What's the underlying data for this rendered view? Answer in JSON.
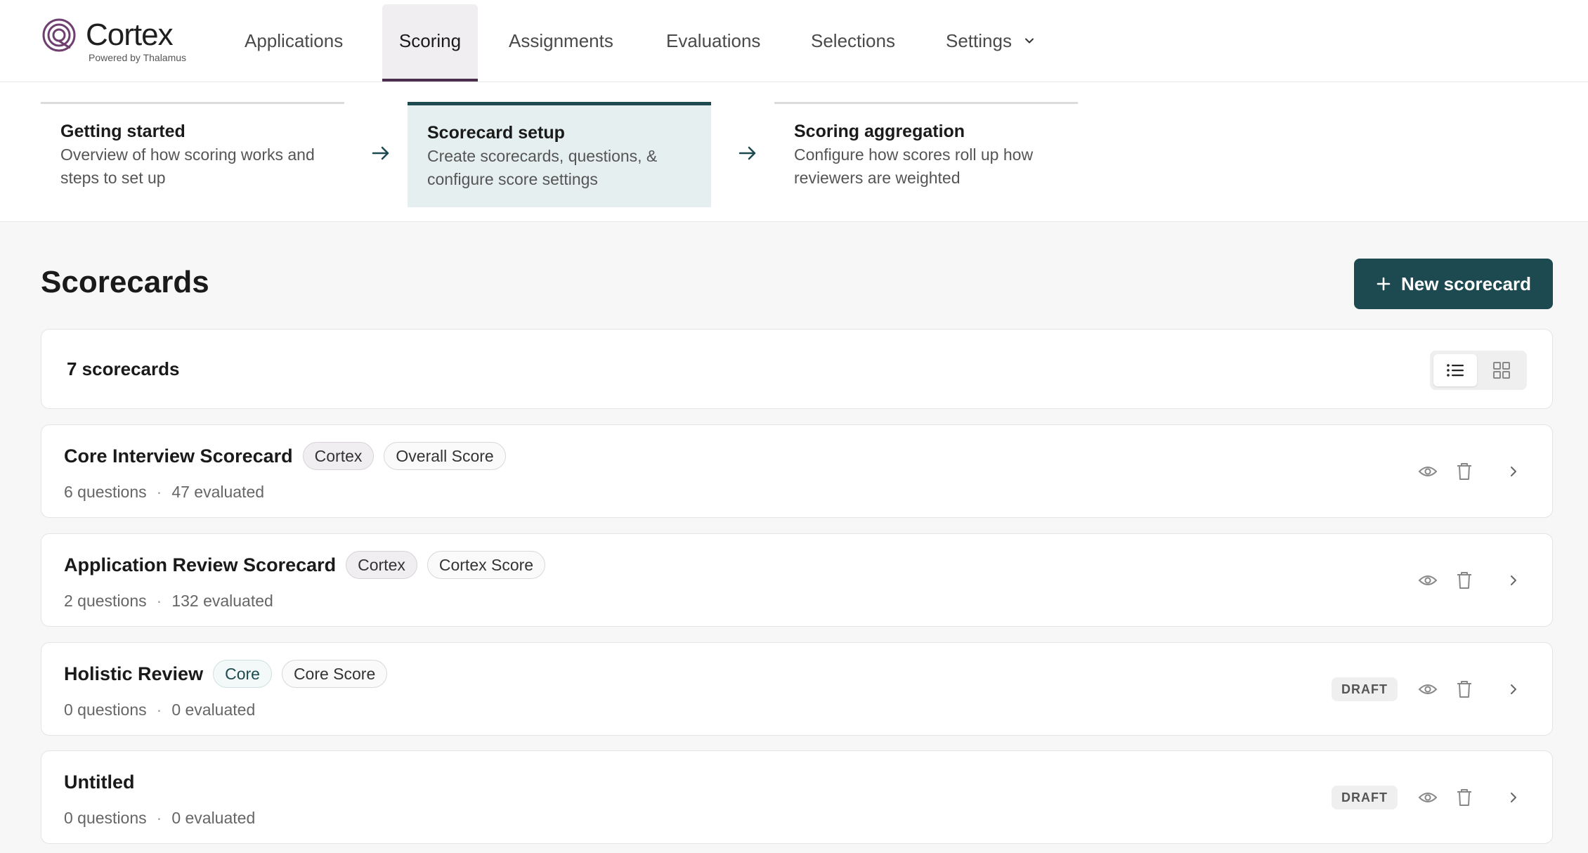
{
  "app": {
    "logo_text": "Cortex",
    "logo_subtext": "Powered by Thalamus"
  },
  "nav": {
    "tabs": [
      {
        "label": "Applications",
        "active": false
      },
      {
        "label": "Scoring",
        "active": true
      },
      {
        "label": "Assignments",
        "active": false
      },
      {
        "label": "Evaluations",
        "active": false
      },
      {
        "label": "Selections",
        "active": false
      },
      {
        "label": "Settings",
        "active": false,
        "has_dropdown": true
      }
    ]
  },
  "steps": [
    {
      "title": "Getting started",
      "description": "Overview of how scoring works and steps to set up",
      "active": false
    },
    {
      "title": "Scorecard setup",
      "description": "Create scorecards, questions, & configure score settings",
      "active": true
    },
    {
      "title": "Scoring aggregation",
      "description": "Configure how scores roll up how reviewers are weighted",
      "active": false
    }
  ],
  "page": {
    "title": "Scorecards",
    "new_button_label": "New scorecard",
    "count_label": "7 scorecards"
  },
  "view_toggle": {
    "selected": "list",
    "options": [
      "list-icon",
      "grid-icon"
    ]
  },
  "scorecards": [
    {
      "name": "Core Interview Scorecard",
      "tags": [
        "Cortex",
        "Overall Score"
      ],
      "questions": "6 questions",
      "evaluated": "47 evaluated",
      "draft": ""
    },
    {
      "name": "Application Review Scorecard",
      "tags": [
        "Cortex",
        "Cortex Score"
      ],
      "questions": "2 questions",
      "evaluated": "132 evaluated",
      "draft": ""
    },
    {
      "name": "Holistic Review",
      "tags": [
        "Core",
        "Core Score"
      ],
      "questions": "0 questions",
      "evaluated": "0 evaluated",
      "draft": "DRAFT"
    },
    {
      "name": "Untitled",
      "tags": [],
      "questions": "0 questions",
      "evaluated": "0 evaluated",
      "draft": "DRAFT"
    }
  ],
  "meta_separator": "·",
  "colors": {
    "primary": "#1d4a50",
    "brand": "#4b2e4d",
    "active_step_bg": "#e5efef",
    "page_bg": "#f7f7f7"
  }
}
